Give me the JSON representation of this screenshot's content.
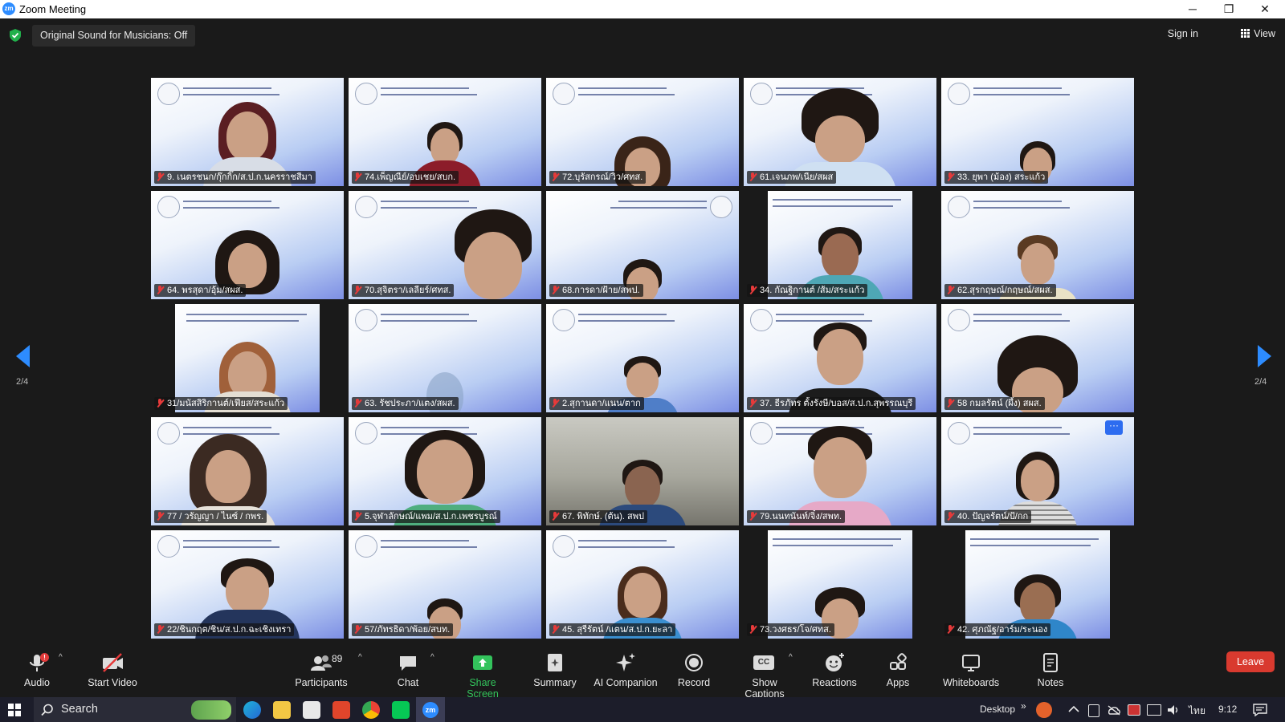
{
  "window": {
    "title": "Zoom Meeting",
    "app_icon": "zm"
  },
  "window_controls": {
    "minimize": "─",
    "restore": "❐",
    "close": "✕"
  },
  "top_bar": {
    "original_sound": "Original Sound for Musicians: Off",
    "sign_in": "Sign in",
    "view": "View"
  },
  "pager": {
    "left": "2/4",
    "right": "2/4"
  },
  "participants_tiles": [
    "9. เนตรชนก/กุ๊กกิ๊ก/ส.ป.ก.นครราชสีมา",
    "74.เพ็ญณีย์/อบเชย/สบก.",
    "72.บุรัสกรณ์/วิว/ศทส.",
    "61.เจนภพ/เนีย/สผส",
    "33. ยุพา (ม้อง) สระแก้ว",
    "64. พรสุดา/อุ้ม/สผส.",
    "70.สุจิตรา/เลลียร์/ศทส.",
    "68.การดา/ฝ้าย/สพป.",
    "34. กัณฐิกานต์ /ส้ม/สระแก้ว",
    "62.สุรกฤษณ์/กฤษณ์/สผส.",
    "31/มนัสสิริกานต์/เฟียส/สระแก้ว",
    "63. รัชประภา/แตง/สผส.",
    "2.สุกานดา/แนน/ตาก",
    "37. ธีรภัทร ตั้งรังษี/บอส/ส.ป.ก.สุพรรณบุรี",
    "58 กมลรัตน์ (ผึ้ง) สผส.",
    "77 / วรัญญา / ไนซ์ / กพร.",
    "5.จุฬาลักษณ์/แพม/ส.ป.ก.เพชรบูรณ์",
    "67. พิทักษ์. (ต้น). สพป",
    "79.นนทนันท์/จิ๋ง/สพท.",
    "40. ปัญจรัตน์/ป้/กก",
    "22/ชินกฤต/ชิน/ส.ป.ก.ฉะเชิงเทรา",
    "57/ภัทรธิดา/พ้อย/สบท.",
    "45. สุรีรัตน์ /แตน/ส.ป.ก.ยะลา",
    "73.วงศธร/โจ/ศทส.",
    "42. ศุภณัฐ/อาร์ม/ระนอง"
  ],
  "tile_more_button": "···",
  "toolbar": {
    "audio": "Audio",
    "start_video": "Start Video",
    "participants": "Participants",
    "participants_count": "89",
    "chat": "Chat",
    "share_screen": "Share Screen",
    "summary": "Summary",
    "ai_companion": "AI Companion",
    "record": "Record",
    "show_captions": "Show Captions",
    "reactions": "Reactions",
    "apps": "Apps",
    "whiteboards": "Whiteboards",
    "notes": "Notes",
    "leave": "Leave",
    "audio_alert": "!",
    "caret": "^",
    "cc": "CC"
  },
  "taskbar": {
    "search": "Search",
    "desktop": "Desktop",
    "chevron": "»",
    "language": "ไทย",
    "time": "9:12",
    "zoom_icon": "zm"
  },
  "colors": {
    "accent_blue": "#2d8cff",
    "share_green": "#33c35c",
    "leave_red": "#d93a2f",
    "muted_red": "#e63a3a"
  }
}
